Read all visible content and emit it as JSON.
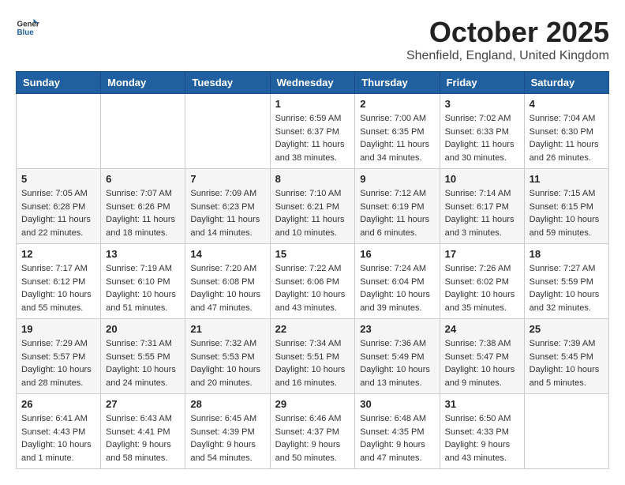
{
  "header": {
    "logo_general": "General",
    "logo_blue": "Blue",
    "month": "October 2025",
    "location": "Shenfield, England, United Kingdom"
  },
  "weekdays": [
    "Sunday",
    "Monday",
    "Tuesday",
    "Wednesday",
    "Thursday",
    "Friday",
    "Saturday"
  ],
  "weeks": [
    [
      {
        "day": "",
        "info": ""
      },
      {
        "day": "",
        "info": ""
      },
      {
        "day": "",
        "info": ""
      },
      {
        "day": "1",
        "info": "Sunrise: 6:59 AM\nSunset: 6:37 PM\nDaylight: 11 hours\nand 38 minutes."
      },
      {
        "day": "2",
        "info": "Sunrise: 7:00 AM\nSunset: 6:35 PM\nDaylight: 11 hours\nand 34 minutes."
      },
      {
        "day": "3",
        "info": "Sunrise: 7:02 AM\nSunset: 6:33 PM\nDaylight: 11 hours\nand 30 minutes."
      },
      {
        "day": "4",
        "info": "Sunrise: 7:04 AM\nSunset: 6:30 PM\nDaylight: 11 hours\nand 26 minutes."
      }
    ],
    [
      {
        "day": "5",
        "info": "Sunrise: 7:05 AM\nSunset: 6:28 PM\nDaylight: 11 hours\nand 22 minutes."
      },
      {
        "day": "6",
        "info": "Sunrise: 7:07 AM\nSunset: 6:26 PM\nDaylight: 11 hours\nand 18 minutes."
      },
      {
        "day": "7",
        "info": "Sunrise: 7:09 AM\nSunset: 6:23 PM\nDaylight: 11 hours\nand 14 minutes."
      },
      {
        "day": "8",
        "info": "Sunrise: 7:10 AM\nSunset: 6:21 PM\nDaylight: 11 hours\nand 10 minutes."
      },
      {
        "day": "9",
        "info": "Sunrise: 7:12 AM\nSunset: 6:19 PM\nDaylight: 11 hours\nand 6 minutes."
      },
      {
        "day": "10",
        "info": "Sunrise: 7:14 AM\nSunset: 6:17 PM\nDaylight: 11 hours\nand 3 minutes."
      },
      {
        "day": "11",
        "info": "Sunrise: 7:15 AM\nSunset: 6:15 PM\nDaylight: 10 hours\nand 59 minutes."
      }
    ],
    [
      {
        "day": "12",
        "info": "Sunrise: 7:17 AM\nSunset: 6:12 PM\nDaylight: 10 hours\nand 55 minutes."
      },
      {
        "day": "13",
        "info": "Sunrise: 7:19 AM\nSunset: 6:10 PM\nDaylight: 10 hours\nand 51 minutes."
      },
      {
        "day": "14",
        "info": "Sunrise: 7:20 AM\nSunset: 6:08 PM\nDaylight: 10 hours\nand 47 minutes."
      },
      {
        "day": "15",
        "info": "Sunrise: 7:22 AM\nSunset: 6:06 PM\nDaylight: 10 hours\nand 43 minutes."
      },
      {
        "day": "16",
        "info": "Sunrise: 7:24 AM\nSunset: 6:04 PM\nDaylight: 10 hours\nand 39 minutes."
      },
      {
        "day": "17",
        "info": "Sunrise: 7:26 AM\nSunset: 6:02 PM\nDaylight: 10 hours\nand 35 minutes."
      },
      {
        "day": "18",
        "info": "Sunrise: 7:27 AM\nSunset: 5:59 PM\nDaylight: 10 hours\nand 32 minutes."
      }
    ],
    [
      {
        "day": "19",
        "info": "Sunrise: 7:29 AM\nSunset: 5:57 PM\nDaylight: 10 hours\nand 28 minutes."
      },
      {
        "day": "20",
        "info": "Sunrise: 7:31 AM\nSunset: 5:55 PM\nDaylight: 10 hours\nand 24 minutes."
      },
      {
        "day": "21",
        "info": "Sunrise: 7:32 AM\nSunset: 5:53 PM\nDaylight: 10 hours\nand 20 minutes."
      },
      {
        "day": "22",
        "info": "Sunrise: 7:34 AM\nSunset: 5:51 PM\nDaylight: 10 hours\nand 16 minutes."
      },
      {
        "day": "23",
        "info": "Sunrise: 7:36 AM\nSunset: 5:49 PM\nDaylight: 10 hours\nand 13 minutes."
      },
      {
        "day": "24",
        "info": "Sunrise: 7:38 AM\nSunset: 5:47 PM\nDaylight: 10 hours\nand 9 minutes."
      },
      {
        "day": "25",
        "info": "Sunrise: 7:39 AM\nSunset: 5:45 PM\nDaylight: 10 hours\nand 5 minutes."
      }
    ],
    [
      {
        "day": "26",
        "info": "Sunrise: 6:41 AM\nSunset: 4:43 PM\nDaylight: 10 hours\nand 1 minute."
      },
      {
        "day": "27",
        "info": "Sunrise: 6:43 AM\nSunset: 4:41 PM\nDaylight: 9 hours\nand 58 minutes."
      },
      {
        "day": "28",
        "info": "Sunrise: 6:45 AM\nSunset: 4:39 PM\nDaylight: 9 hours\nand 54 minutes."
      },
      {
        "day": "29",
        "info": "Sunrise: 6:46 AM\nSunset: 4:37 PM\nDaylight: 9 hours\nand 50 minutes."
      },
      {
        "day": "30",
        "info": "Sunrise: 6:48 AM\nSunset: 4:35 PM\nDaylight: 9 hours\nand 47 minutes."
      },
      {
        "day": "31",
        "info": "Sunrise: 6:50 AM\nSunset: 4:33 PM\nDaylight: 9 hours\nand 43 minutes."
      },
      {
        "day": "",
        "info": ""
      }
    ]
  ]
}
